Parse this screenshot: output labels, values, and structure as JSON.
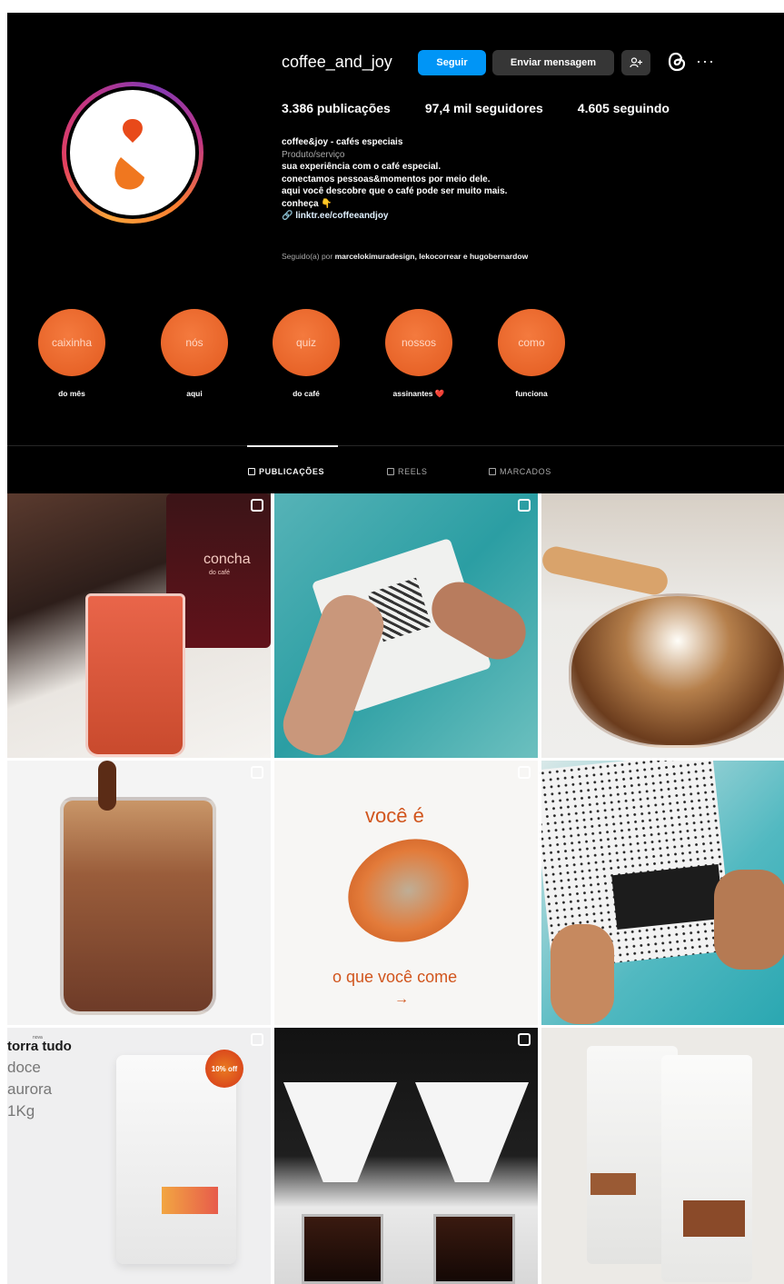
{
  "profile": {
    "username": "coffee_and_joy",
    "follow_label": "Seguir",
    "message_label": "Enviar mensagem",
    "more_label": "···"
  },
  "stats": {
    "posts": "3.386 publicações",
    "followers": "97,4 mil seguidores",
    "following": "4.605 seguindo"
  },
  "bio": {
    "name": "coffee&joy - cafés especiais",
    "category": "Produto/serviço",
    "line1": "sua experiência com o café especial.",
    "line2": "conectamos pessoas&momentos por meio dele.",
    "line3": "aqui você descobre que o café pode ser muito mais.",
    "line4": "conheça 👇",
    "link": "linktr.ee/coffeeandjoy"
  },
  "followed_by": {
    "prefix": "Seguido(a) por",
    "names": "marcelokimuradesign, lekocorrear e hugobernardow"
  },
  "highlights": [
    {
      "title": "caixinha",
      "label": "do mês"
    },
    {
      "title": "nós",
      "label": "aqui"
    },
    {
      "title": "quiz",
      "label": "do café"
    },
    {
      "title": "nossos",
      "label": "assinantes ❤️"
    },
    {
      "title": "como",
      "label": "funciona"
    }
  ],
  "tabs": [
    {
      "label": "PUBLICAÇÕES",
      "active": true
    },
    {
      "label": "REELS",
      "active": false
    },
    {
      "label": "MARCADOS",
      "active": false
    }
  ],
  "posts": {
    "p1_brand": "concha",
    "p1_brand_sub": "do café",
    "p5_top": "você é",
    "p5_bottom": "o que você come",
    "p5_arrow": "→",
    "p7_pre": "nova",
    "p7_title": "torra tudo",
    "p7_line2": "doce",
    "p7_line3": "aurora",
    "p7_line4": "1Kg",
    "p7_badge": "10% off"
  },
  "colors": {
    "accent": "#0095f6",
    "brand": "#e85b22",
    "background": "#000000"
  }
}
